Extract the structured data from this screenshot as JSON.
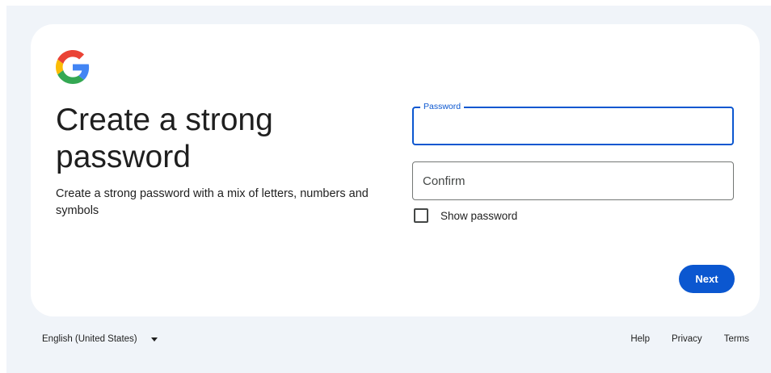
{
  "header": {
    "title": "Create a strong password",
    "subtitle": "Create a strong password with a mix of letters, numbers and symbols"
  },
  "form": {
    "password_label": "Password",
    "password_value": "",
    "confirm_placeholder": "Confirm",
    "confirm_value": "",
    "show_password_label": "Show password",
    "show_password_checked": false,
    "next_label": "Next"
  },
  "footer": {
    "language": "English (United States)",
    "links": [
      "Help",
      "Privacy",
      "Terms"
    ]
  },
  "colors": {
    "accent": "#0b57d0",
    "background": "#f0f4f9"
  },
  "icons": {
    "logo": "google-logo-icon",
    "language_caret": "caret-down-icon"
  }
}
